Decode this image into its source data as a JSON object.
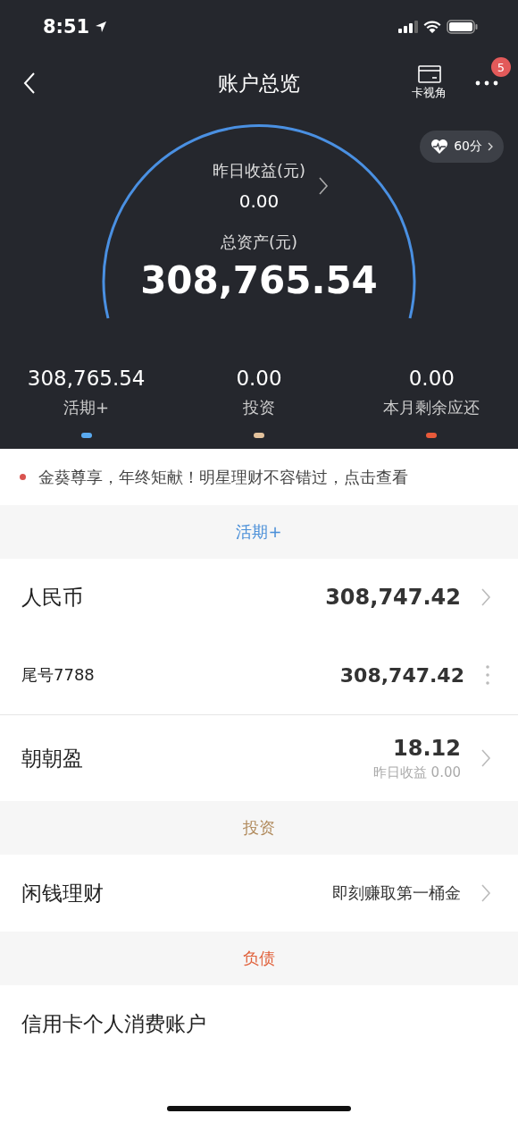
{
  "status_bar": {
    "time": "8:51"
  },
  "nav": {
    "title": "账户总览",
    "card_view": "卡视角",
    "badge": "5"
  },
  "score": {
    "label": "60分"
  },
  "gauge": {
    "yesterday_label": "昨日收益(元)",
    "yesterday_value": "0.00",
    "total_label": "总资产(元)",
    "total_value": "308,765.54"
  },
  "summary": [
    {
      "value": "308,765.54",
      "label": "活期+",
      "color": "#5aaaf0"
    },
    {
      "value": "0.00",
      "label": "投资",
      "color": "#e3c29c"
    },
    {
      "value": "0.00",
      "label": "本月剩余应还",
      "color": "#e85a3a"
    }
  ],
  "notice": {
    "text": "金葵尊享，年终矩献！明星理财不容错过，点击查看"
  },
  "sections": [
    {
      "title": "活期+",
      "color": "#4a8fd8",
      "rows": [
        {
          "kind": "main",
          "label": "人民币",
          "value": "308,747.42"
        },
        {
          "kind": "account",
          "label": "尾号7788",
          "value": "308,747.42"
        },
        {
          "kind": "fund",
          "label": "朝朝盈",
          "value": "18.12",
          "sub": "昨日收益 0.00"
        }
      ]
    },
    {
      "title": "投资",
      "color": "#b08a5c",
      "rows": [
        {
          "kind": "promo",
          "label": "闲钱理财",
          "value": "即刻赚取第一桶金"
        }
      ]
    },
    {
      "title": "负债",
      "color": "#e0603a",
      "rows": [
        {
          "kind": "plain",
          "label": "信用卡个人消费账户"
        }
      ]
    }
  ]
}
